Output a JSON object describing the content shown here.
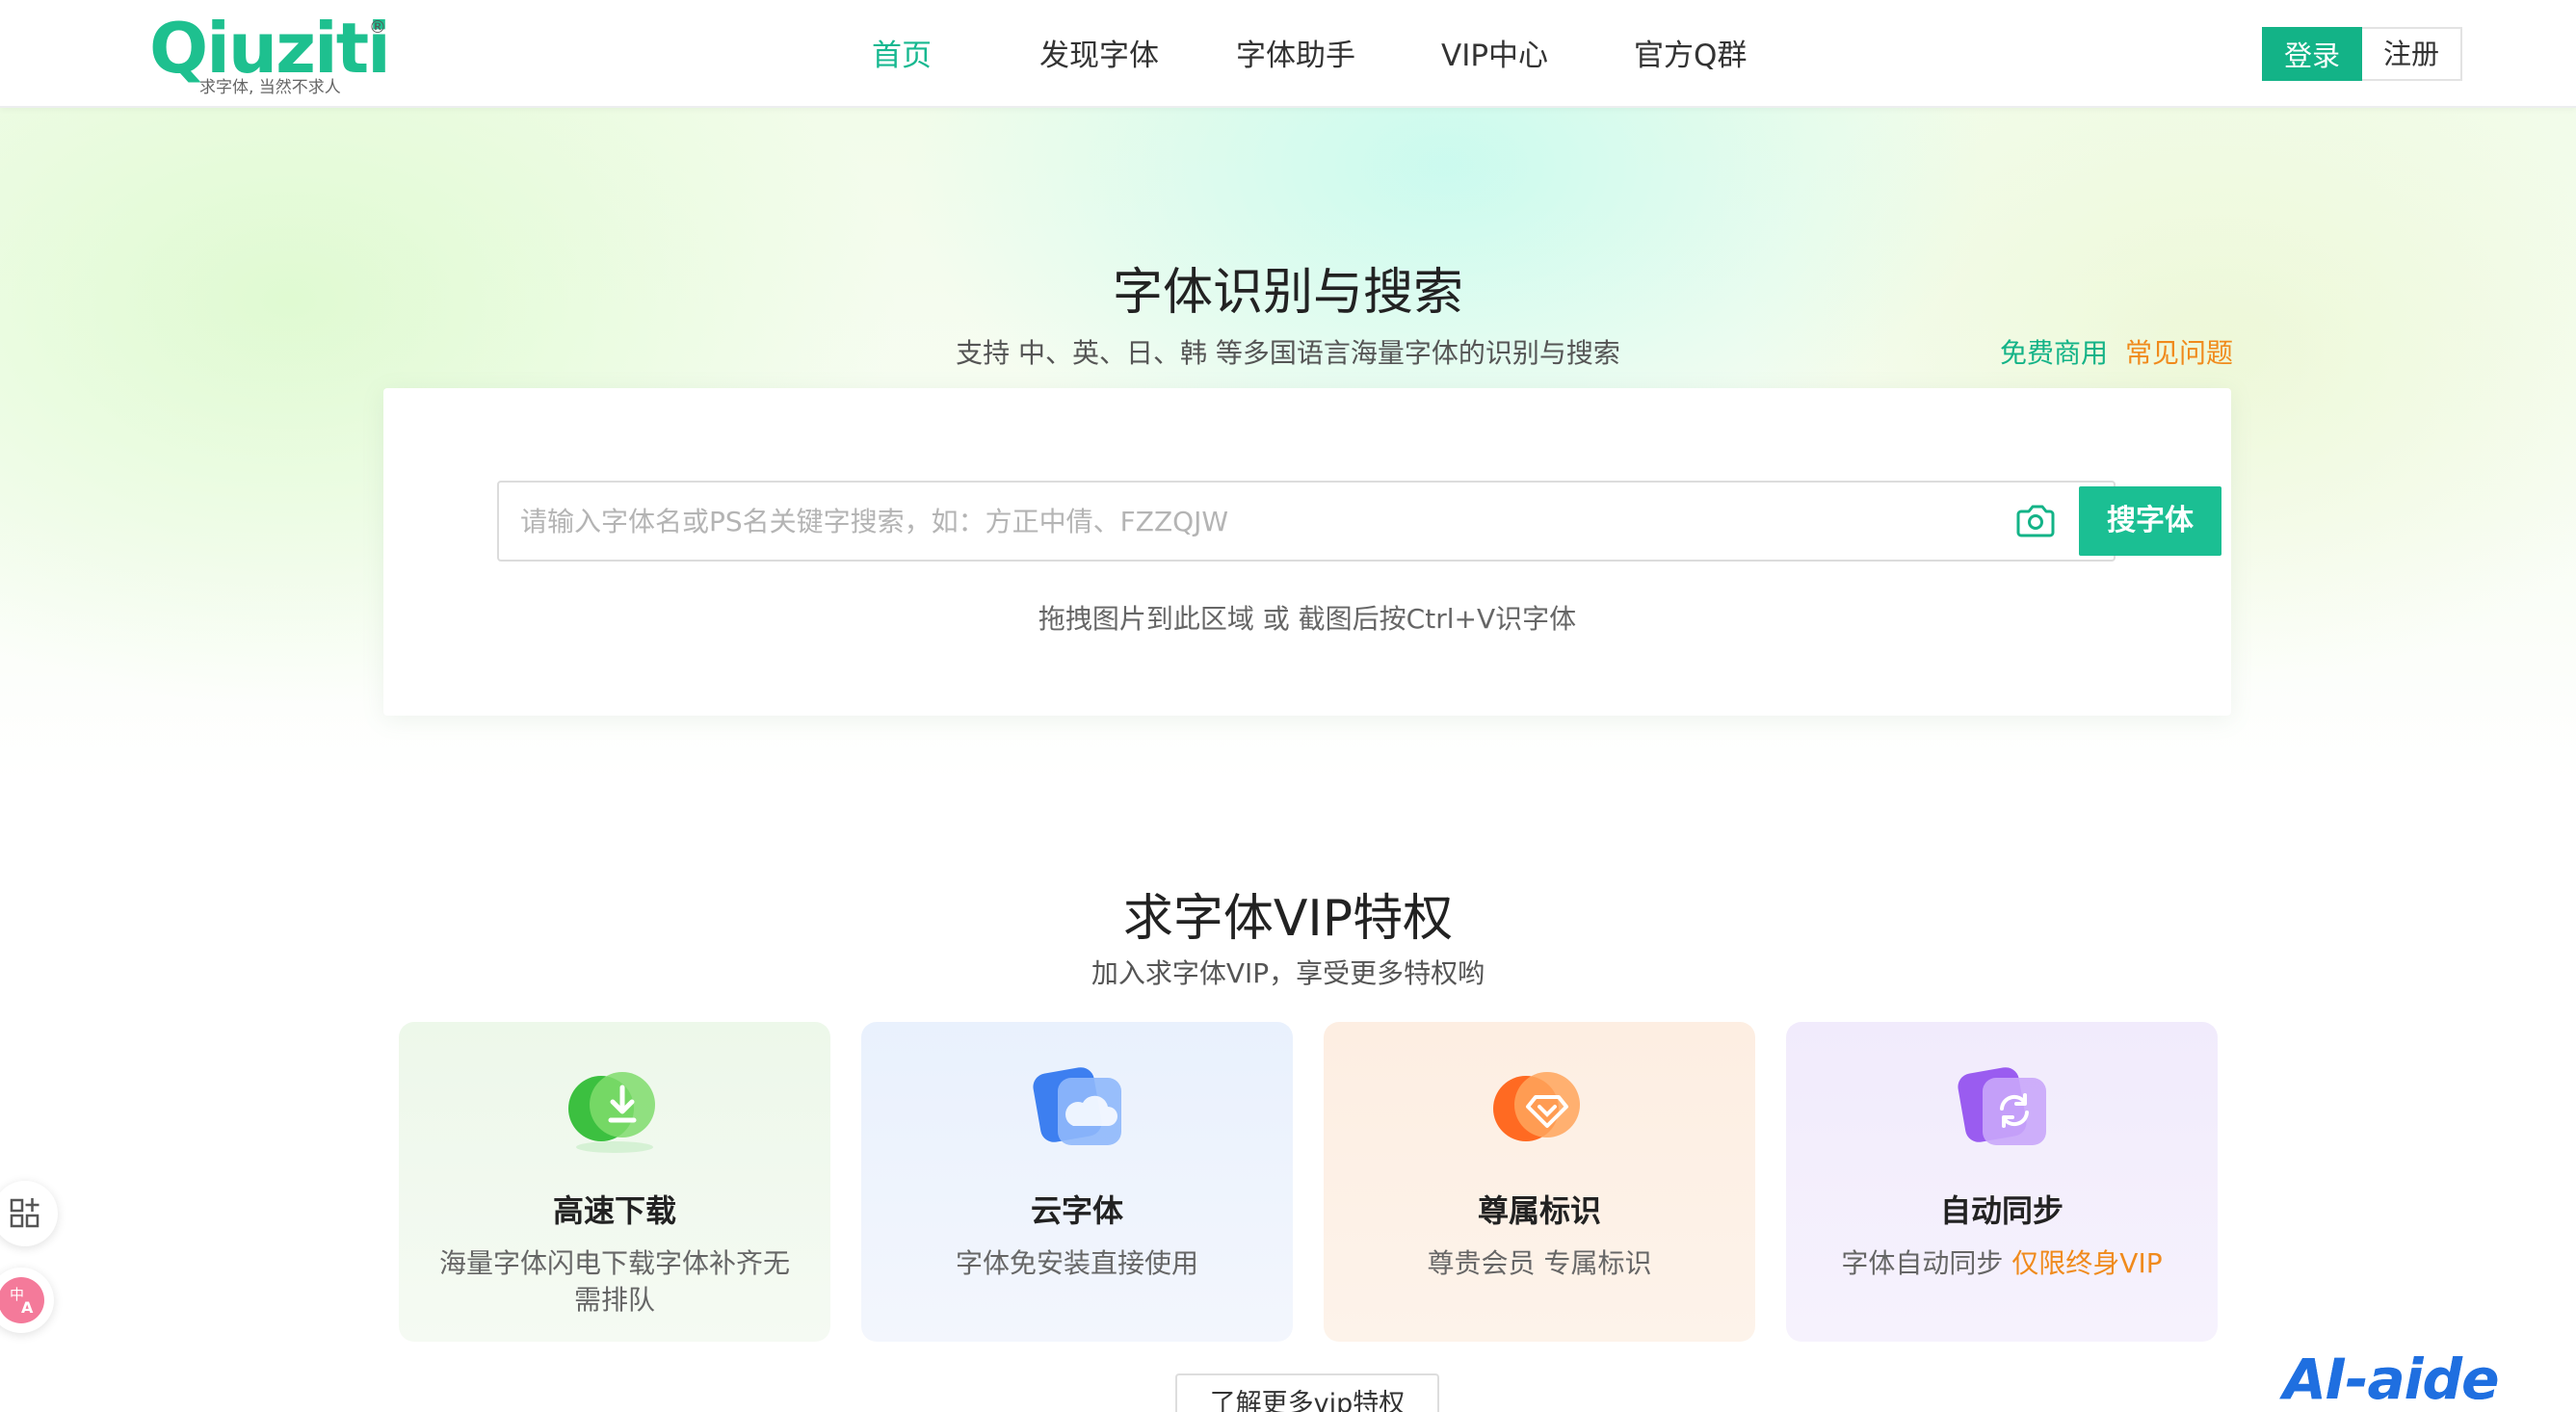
{
  "header": {
    "logo_text": "Qiuziti",
    "logo_reg": "®",
    "logo_slogan": "求字体, 当然不求人",
    "nav": [
      {
        "label": "首页",
        "active": true
      },
      {
        "label": "发现字体",
        "active": false
      },
      {
        "label": "字体助手",
        "active": false
      },
      {
        "label": "VIP中心",
        "active": false
      },
      {
        "label": "官方Q群",
        "active": false
      }
    ],
    "login_label": "登录",
    "register_label": "注册"
  },
  "hero": {
    "title": "字体识别与搜索",
    "subtitle": "支持 中、英、日、韩 等多国语言海量字体的识别与搜索",
    "link_free": "免费商用",
    "link_faq": "常见问题",
    "search": {
      "placeholder": "请输入字体名或PS名关键字搜索，如：方正中倩、FZZQJW",
      "value": "",
      "button_label": "搜字体",
      "camera_icon": "camera-icon"
    },
    "drop_hint": "拖拽图片到此区域 或 截图后按Ctrl+V识字体"
  },
  "vip": {
    "title": "求字体VIP特权",
    "subtitle": "加入求字体VIP，享受更多特权哟",
    "cards": [
      {
        "name": "高速下载",
        "desc": "海量字体闪电下载字体补齐无需排队",
        "highlight": "",
        "icon": "download-icon",
        "color": "#3cc040"
      },
      {
        "name": "云字体",
        "desc": "字体免安装直接使用",
        "highlight": "",
        "icon": "cloud-icon",
        "color": "#3d7ff0"
      },
      {
        "name": "尊属标识",
        "desc": "尊贵会员 专属标识",
        "highlight": "",
        "icon": "diamond-icon",
        "color": "#ff7a2a"
      },
      {
        "name": "自动同步",
        "desc": "字体自动同步 ",
        "highlight": "仅限终身VIP",
        "icon": "sync-icon",
        "color": "#9a5cf0"
      }
    ],
    "more_label": "了解更多vip特权"
  },
  "side_tools": {
    "apps_icon": "apps-icon",
    "translate_icon": "translate-icon"
  },
  "watermark": "AI-aide"
}
